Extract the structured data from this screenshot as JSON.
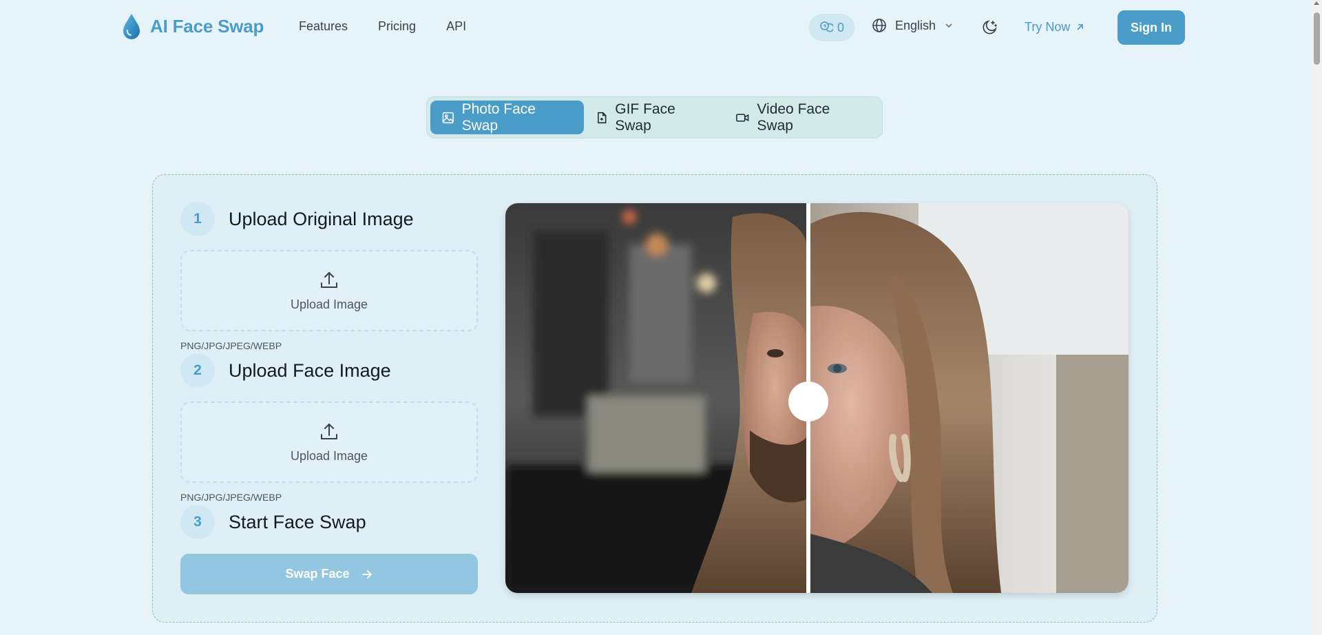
{
  "header": {
    "logo_text": "AI Face Swap",
    "nav": [
      "Features",
      "Pricing",
      "API"
    ],
    "credits": "0",
    "language": "English",
    "try_now": "Try Now",
    "sign_in": "Sign In"
  },
  "tabs": [
    {
      "label": "Photo Face Swap",
      "icon": "image-icon",
      "active": true
    },
    {
      "label": "GIF Face Swap",
      "icon": "gif-file-icon",
      "active": false
    },
    {
      "label": "Video Face Swap",
      "icon": "video-icon",
      "active": false
    }
  ],
  "steps": [
    {
      "number": "1",
      "title": "Upload Original Image",
      "upload_label": "Upload Image",
      "formats": "PNG/JPG/JPEG/WEBP"
    },
    {
      "number": "2",
      "title": "Upload Face Image",
      "upload_label": "Upload Image",
      "formats": "PNG/JPG/JPEG/WEBP"
    },
    {
      "number": "3",
      "title": "Start Face Swap"
    }
  ],
  "swap_button": "Swap Face",
  "colors": {
    "accent": "#4a9cc9",
    "background": "#e6f4fa",
    "button_disabled": "#93c6e0"
  }
}
